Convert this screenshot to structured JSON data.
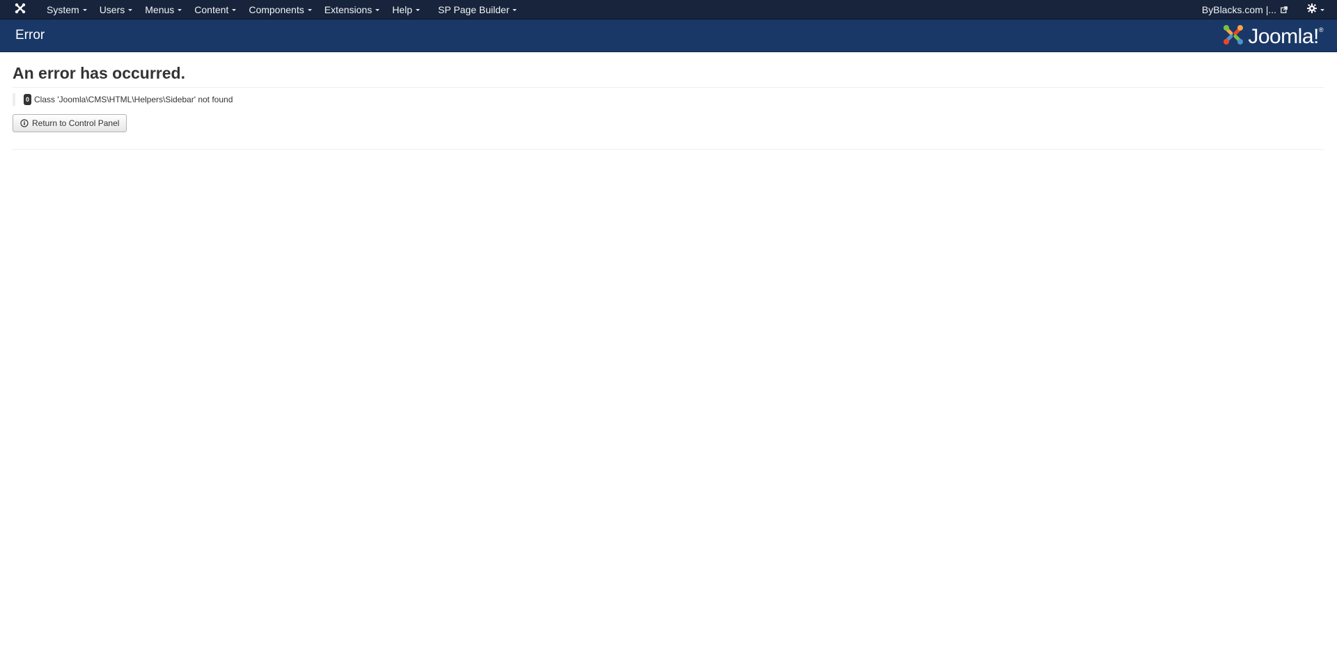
{
  "navbar": {
    "menu": [
      {
        "label": "System"
      },
      {
        "label": "Users"
      },
      {
        "label": "Menus"
      },
      {
        "label": "Content"
      },
      {
        "label": "Components"
      },
      {
        "label": "Extensions"
      },
      {
        "label": "Help"
      },
      {
        "label": "SP Page Builder"
      }
    ],
    "site_link": "ByBlacks.com |...",
    "icons": {
      "brand": "joomla-icon",
      "site": "external-link-icon",
      "settings": "gear-icon"
    }
  },
  "header": {
    "title": "Error",
    "logo_text": "Joomla!",
    "logo_mark": "®"
  },
  "error": {
    "heading": "An error has occurred.",
    "code": "0",
    "message": "Class 'Joomla\\CMS\\HTML\\Helpers\\Sidebar' not found",
    "button_label": "Return to Control Panel",
    "button_icon": "dashboard-icon"
  },
  "colors": {
    "navbar_bg": "#17243b",
    "header_bg": "#1a3867",
    "text": "#333333"
  }
}
